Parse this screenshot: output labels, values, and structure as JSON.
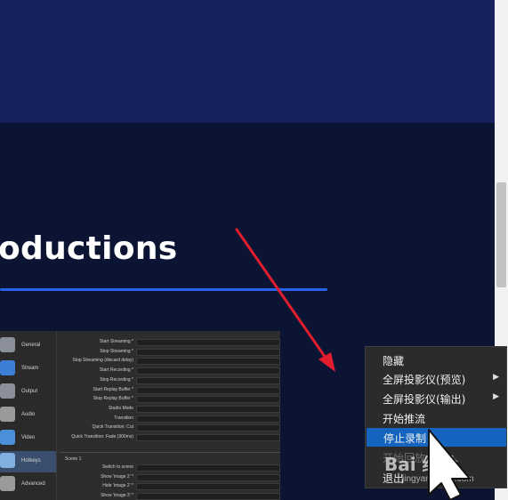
{
  "page": {
    "heading": "oductions",
    "colors": {
      "top_band": "#16215e",
      "page_bg": "#0b1533",
      "underline": "#2563eb",
      "arrow": "#e11d2e",
      "menu_bg": "#2b2b2b",
      "menu_highlight": "#1565c0"
    }
  },
  "obs_settings": {
    "nav": [
      {
        "label": "General",
        "icon": "gear-icon"
      },
      {
        "label": "Stream",
        "icon": "globe-icon"
      },
      {
        "label": "Output",
        "icon": "output-icon"
      },
      {
        "label": "Audio",
        "icon": "speaker-icon"
      },
      {
        "label": "Video",
        "icon": "monitor-icon"
      },
      {
        "label": "Hotkeys",
        "icon": "keyboard-icon",
        "active": true
      },
      {
        "label": "Advanced",
        "icon": "gears-icon"
      }
    ],
    "hotkeys": [
      "Start Streaming *",
      "Stop Streaming *",
      "Stop Streaming (discard delay)",
      "Start Recording *",
      "Stop Recording *",
      "Start Replay Buffer *",
      "Stop Replay Buffer *",
      "Studio Mode",
      "Transition",
      "Quick Transition: Cut",
      "Quick Transition: Fade (300ms)"
    ],
    "scene_title": "Scene 1",
    "scene_hotkeys": [
      "Switch to scene",
      "Show 'image 2' *",
      "Hide 'image 2' *",
      "Show 'image 3' *"
    ]
  },
  "context_menu": {
    "items": [
      {
        "label": "隐藏",
        "submenu": false,
        "state": "normal"
      },
      {
        "label": "全屏投影仪(预览)",
        "submenu": true,
        "state": "normal"
      },
      {
        "label": "全屏投影仪(输出)",
        "submenu": true,
        "state": "normal"
      },
      {
        "label": "开始推流",
        "submenu": false,
        "state": "normal"
      },
      {
        "label": "停止录制",
        "submenu": false,
        "state": "highlighted"
      },
      {
        "label": "开始回放",
        "submenu": false,
        "state": "disabled"
      },
      {
        "label": "退出",
        "submenu": false,
        "state": "normal"
      }
    ]
  },
  "watermark": {
    "brand": "Bai 经验",
    "url": "jingyan.baidu.com"
  }
}
